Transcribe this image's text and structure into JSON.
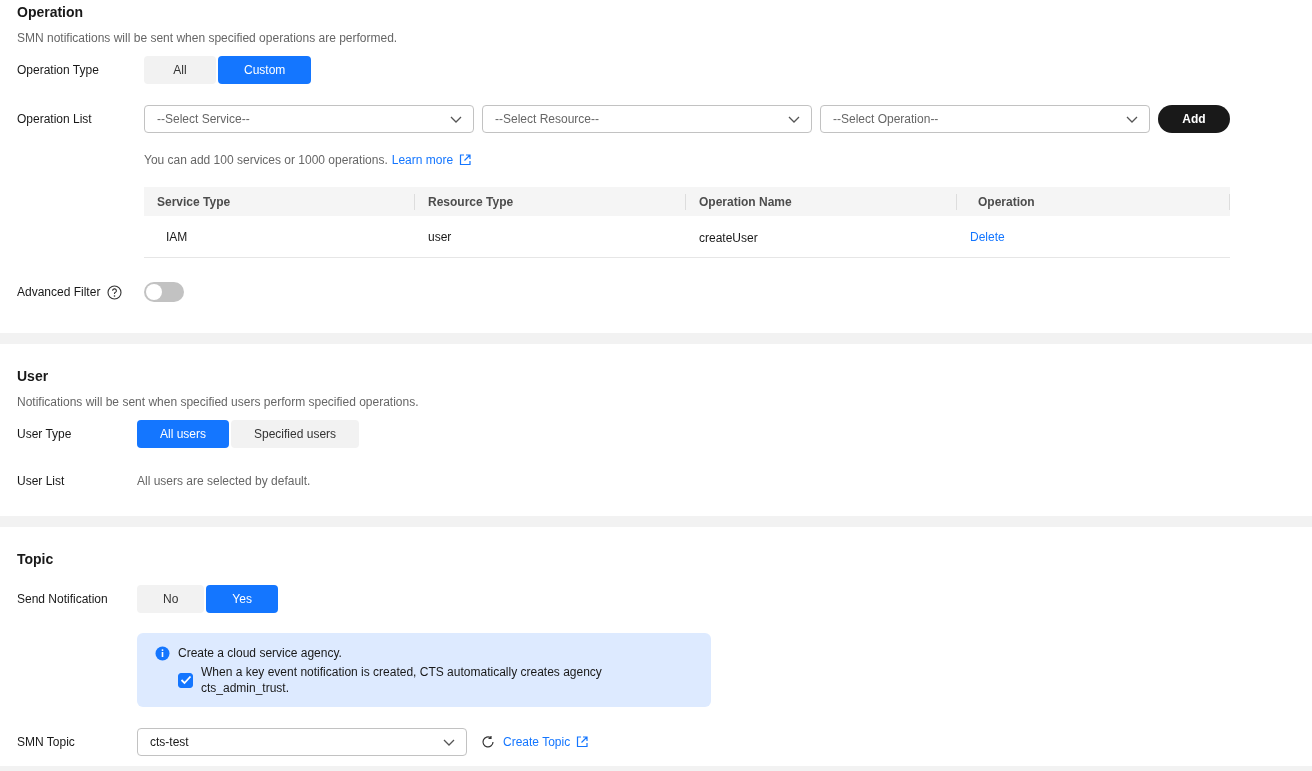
{
  "sections": [
    {
      "kind": "operation",
      "title": "Operation",
      "description": "SMN notifications will be sent when specified operations are performed.",
      "operation_type": {
        "label": "Operation Type",
        "options": [
          {
            "label": "All",
            "selected": false
          },
          {
            "label": "Custom",
            "selected": true
          }
        ]
      },
      "operation_list": {
        "label": "Operation List",
        "selects": [
          {
            "placeholder": "--Select Service--"
          },
          {
            "placeholder": "--Select Resource--"
          },
          {
            "placeholder": "--Select Operation--"
          }
        ],
        "add_button": "Add",
        "hint": "You can add 100 services or 1000 operations.",
        "hint_link": "Learn more",
        "table": {
          "columns": [
            "Service Type",
            "Resource Type",
            "Operation Name",
            "Operation"
          ],
          "rows": [
            {
              "cells": [
                "IAM",
                "user",
                "createUser"
              ],
              "action": "Delete"
            }
          ]
        }
      },
      "advanced_filter": {
        "label": "Advanced Filter",
        "on": false
      }
    },
    {
      "kind": "user",
      "title": "User",
      "description": "Notifications will be sent when specified users perform specified operations.",
      "user_type": {
        "label": "User Type",
        "options": [
          {
            "label": "All users",
            "selected": true
          },
          {
            "label": "Specified users",
            "selected": false
          }
        ]
      },
      "user_list": {
        "label": "User List",
        "value": "All users are selected by default."
      }
    },
    {
      "kind": "topic",
      "title": "Topic",
      "send_notification": {
        "label": "Send Notification",
        "options": [
          {
            "label": "No",
            "selected": false
          },
          {
            "label": "Yes",
            "selected": true
          }
        ]
      },
      "notice": {
        "title": "Create a cloud service agency.",
        "checkbox_label": "When a key event notification is created, CTS automatically creates agency cts_admin_trust.",
        "checked": true
      },
      "smn_topic": {
        "label": "SMN Topic",
        "value": "cts-test",
        "link": "Create Topic"
      }
    }
  ]
}
